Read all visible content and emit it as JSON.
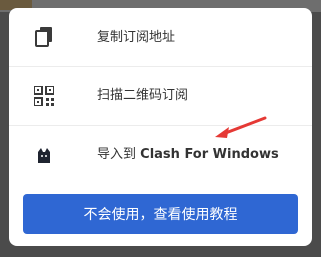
{
  "menu": {
    "items": [
      {
        "label": "复制订阅地址",
        "icon": "copy-icon"
      },
      {
        "label": "扫描二维码订阅",
        "icon": "qr-code-icon"
      },
      {
        "label_prefix": "导入到",
        "label_app": "Clash For Windows",
        "icon": "cat-icon"
      }
    ]
  },
  "help_button": {
    "label": "不会使用，查看使用教程"
  },
  "colors": {
    "primary": "#2f67d3",
    "arrow": "#e53935",
    "text": "#333333"
  }
}
